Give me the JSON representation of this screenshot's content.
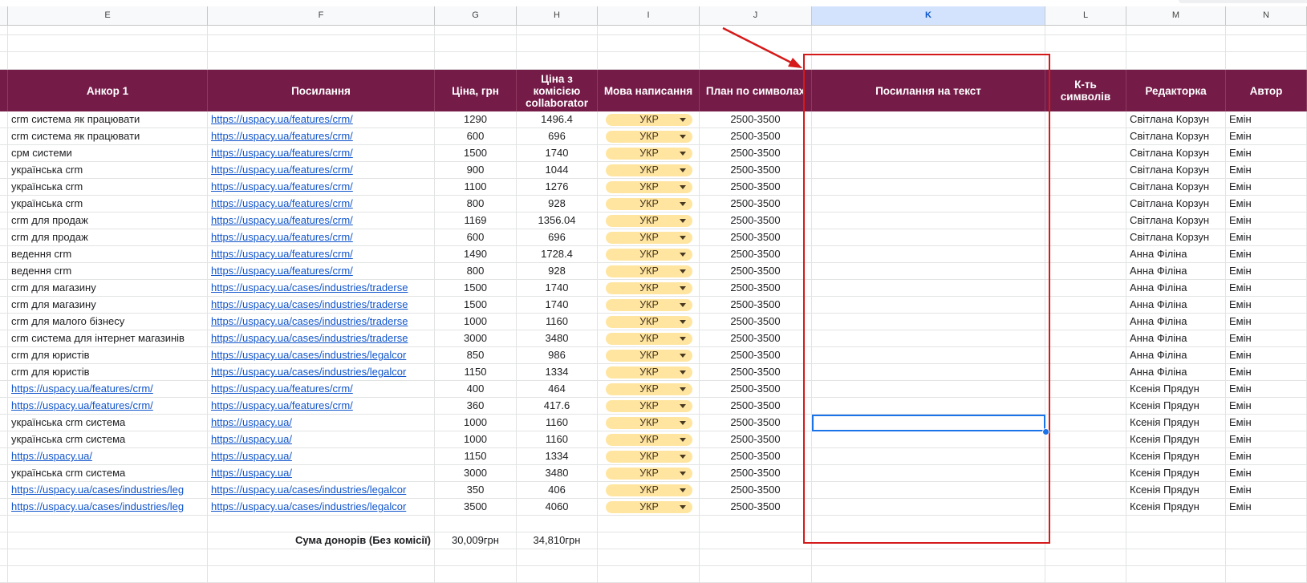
{
  "columns": [
    {
      "letter": "E",
      "selected": false
    },
    {
      "letter": "F",
      "selected": false
    },
    {
      "letter": "G",
      "selected": false
    },
    {
      "letter": "H",
      "selected": false
    },
    {
      "letter": "I",
      "selected": false
    },
    {
      "letter": "J",
      "selected": false
    },
    {
      "letter": "K",
      "selected": true
    },
    {
      "letter": "L",
      "selected": false
    },
    {
      "letter": "M",
      "selected": false
    },
    {
      "letter": "N",
      "selected": false
    }
  ],
  "header": [
    "Анкор 1",
    "Посилання",
    "Ціна, грн",
    "Ціна з комісією collaborator",
    "Мова написання",
    "План по символах",
    "Посилання на текст",
    "К-ть символів",
    "Редакторка",
    "Автор"
  ],
  "rows": [
    {
      "anchor": "crm система як працювати",
      "anchor_link": false,
      "url": "https://uspacy.ua/features/crm/",
      "price": "1290",
      "price_comm": "1496.4",
      "lang": "УКР",
      "plan": "2500-3500",
      "text_link": "",
      "chars": "",
      "editor": "Світлана Корзун",
      "author": "Емін"
    },
    {
      "anchor": "crm система як працювати",
      "anchor_link": false,
      "url": "https://uspacy.ua/features/crm/",
      "price": "600",
      "price_comm": "696",
      "lang": "УКР",
      "plan": "2500-3500",
      "text_link": "",
      "chars": "",
      "editor": "Світлана Корзун",
      "author": "Емін"
    },
    {
      "anchor": "срм системи",
      "anchor_link": false,
      "url": "https://uspacy.ua/features/crm/",
      "price": "1500",
      "price_comm": "1740",
      "lang": "УКР",
      "plan": "2500-3500",
      "text_link": "",
      "chars": "",
      "editor": "Світлана Корзун",
      "author": "Емін"
    },
    {
      "anchor": "українська crm",
      "anchor_link": false,
      "url": "https://uspacy.ua/features/crm/",
      "price": "900",
      "price_comm": "1044",
      "lang": "УКР",
      "plan": "2500-3500",
      "text_link": "",
      "chars": "",
      "editor": "Світлана Корзун",
      "author": "Емін"
    },
    {
      "anchor": "українська crm",
      "anchor_link": false,
      "url": "https://uspacy.ua/features/crm/",
      "price": "1100",
      "price_comm": "1276",
      "lang": "УКР",
      "plan": "2500-3500",
      "text_link": "",
      "chars": "",
      "editor": "Світлана Корзун",
      "author": "Емін"
    },
    {
      "anchor": "українська crm",
      "anchor_link": false,
      "url": "https://uspacy.ua/features/crm/",
      "price": "800",
      "price_comm": "928",
      "lang": "УКР",
      "plan": "2500-3500",
      "text_link": "",
      "chars": "",
      "editor": "Світлана Корзун",
      "author": "Емін"
    },
    {
      "anchor": "crm для продаж",
      "anchor_link": false,
      "url": "https://uspacy.ua/features/crm/",
      "price": "1169",
      "price_comm": "1356.04",
      "lang": "УКР",
      "plan": "2500-3500",
      "text_link": "",
      "chars": "",
      "editor": "Світлана Корзун",
      "author": "Емін"
    },
    {
      "anchor": "crm для продаж",
      "anchor_link": false,
      "url": "https://uspacy.ua/features/crm/",
      "price": "600",
      "price_comm": "696",
      "lang": "УКР",
      "plan": "2500-3500",
      "text_link": "",
      "chars": "",
      "editor": "Світлана Корзун",
      "author": "Емін"
    },
    {
      "anchor": "ведення crm",
      "anchor_link": false,
      "url": "https://uspacy.ua/features/crm/",
      "price": "1490",
      "price_comm": "1728.4",
      "lang": "УКР",
      "plan": "2500-3500",
      "text_link": "",
      "chars": "",
      "editor": "Анна Філіна",
      "author": "Емін"
    },
    {
      "anchor": "ведення crm",
      "anchor_link": false,
      "url": "https://uspacy.ua/features/crm/",
      "price": "800",
      "price_comm": "928",
      "lang": "УКР",
      "plan": "2500-3500",
      "text_link": "",
      "chars": "",
      "editor": "Анна Філіна",
      "author": "Емін"
    },
    {
      "anchor": "crm для магазину",
      "anchor_link": false,
      "url": "https://uspacy.ua/cases/industries/traderse",
      "price": "1500",
      "price_comm": "1740",
      "lang": "УКР",
      "plan": "2500-3500",
      "text_link": "",
      "chars": "",
      "editor": "Анна Філіна",
      "author": "Емін"
    },
    {
      "anchor": "crm для магазину",
      "anchor_link": false,
      "url": "https://uspacy.ua/cases/industries/traderse",
      "price": "1500",
      "price_comm": "1740",
      "lang": "УКР",
      "plan": "2500-3500",
      "text_link": "",
      "chars": "",
      "editor": "Анна Філіна",
      "author": "Емін"
    },
    {
      "anchor": "crm для малого бізнесу",
      "anchor_link": false,
      "url": "https://uspacy.ua/cases/industries/traderse",
      "price": "1000",
      "price_comm": "1160",
      "lang": "УКР",
      "plan": "2500-3500",
      "text_link": "",
      "chars": "",
      "editor": "Анна Філіна",
      "author": "Емін"
    },
    {
      "anchor": "crm система для інтернет магазинів",
      "anchor_link": false,
      "url": "https://uspacy.ua/cases/industries/traderse",
      "price": "3000",
      "price_comm": "3480",
      "lang": "УКР",
      "plan": "2500-3500",
      "text_link": "",
      "chars": "",
      "editor": "Анна Філіна",
      "author": "Емін"
    },
    {
      "anchor": "crm для юристів",
      "anchor_link": false,
      "url": "https://uspacy.ua/cases/industries/legalcor",
      "price": "850",
      "price_comm": "986",
      "lang": "УКР",
      "plan": "2500-3500",
      "text_link": "",
      "chars": "",
      "editor": "Анна Філіна",
      "author": "Емін"
    },
    {
      "anchor": "crm для юристів",
      "anchor_link": false,
      "url": "https://uspacy.ua/cases/industries/legalcor",
      "price": "1150",
      "price_comm": "1334",
      "lang": "УКР",
      "plan": "2500-3500",
      "text_link": "",
      "chars": "",
      "editor": "Анна Філіна",
      "author": "Емін"
    },
    {
      "anchor": "https://uspacy.ua/features/crm/",
      "anchor_link": true,
      "url": "https://uspacy.ua/features/crm/",
      "price": "400",
      "price_comm": "464",
      "lang": "УКР",
      "plan": "2500-3500",
      "text_link": "",
      "chars": "",
      "editor": "Ксенія Прядун",
      "author": "Емін"
    },
    {
      "anchor": "https://uspacy.ua/features/crm/",
      "anchor_link": true,
      "url": "https://uspacy.ua/features/crm/",
      "price": "360",
      "price_comm": "417.6",
      "lang": "УКР",
      "plan": "2500-3500",
      "text_link": "",
      "chars": "",
      "editor": "Ксенія Прядун",
      "author": "Емін"
    },
    {
      "anchor": "українська crm система",
      "anchor_link": false,
      "url": "https://uspacy.ua/",
      "price": "1000",
      "price_comm": "1160",
      "lang": "УКР",
      "plan": "2500-3500",
      "text_link": "",
      "chars": "",
      "editor": "Ксенія Прядун",
      "author": "Емін"
    },
    {
      "anchor": "українська crm система",
      "anchor_link": false,
      "url": "https://uspacy.ua/",
      "price": "1000",
      "price_comm": "1160",
      "lang": "УКР",
      "plan": "2500-3500",
      "text_link": "",
      "chars": "",
      "editor": "Ксенія Прядун",
      "author": "Емін"
    },
    {
      "anchor": "https://uspacy.ua/",
      "anchor_link": true,
      "url": "https://uspacy.ua/",
      "price": "1150",
      "price_comm": "1334",
      "lang": "УКР",
      "plan": "2500-3500",
      "text_link": "",
      "chars": "",
      "editor": "Ксенія Прядун",
      "author": "Емін"
    },
    {
      "anchor": "українська crm система",
      "anchor_link": false,
      "url": "https://uspacy.ua/",
      "price": "3000",
      "price_comm": "3480",
      "lang": "УКР",
      "plan": "2500-3500",
      "text_link": "",
      "chars": "",
      "editor": "Ксенія Прядун",
      "author": "Емін"
    },
    {
      "anchor": "https://uspacy.ua/cases/industries/leg",
      "anchor_link": true,
      "url": "https://uspacy.ua/cases/industries/legalcor",
      "price": "350",
      "price_comm": "406",
      "lang": "УКР",
      "plan": "2500-3500",
      "text_link": "",
      "chars": "",
      "editor": "Ксенія Прядун",
      "author": "Емін"
    },
    {
      "anchor": "https://uspacy.ua/cases/industries/leg",
      "anchor_link": true,
      "url": "https://uspacy.ua/cases/industries/legalcor",
      "price": "3500",
      "price_comm": "4060",
      "lang": "УКР",
      "plan": "2500-3500",
      "text_link": "",
      "chars": "",
      "editor": "Ксенія Прядун",
      "author": "Емін"
    }
  ],
  "summary": {
    "label": "Сума донорів (Без комісії)",
    "total": "30,009грн",
    "total_comm": "34,810грн"
  },
  "colors": {
    "header_bg": "#741b47",
    "chip_bg": "#ffe5a0",
    "highlight_box": "#d51a1a",
    "arrow": "#d51a1a",
    "selection": "#1a73e8"
  }
}
